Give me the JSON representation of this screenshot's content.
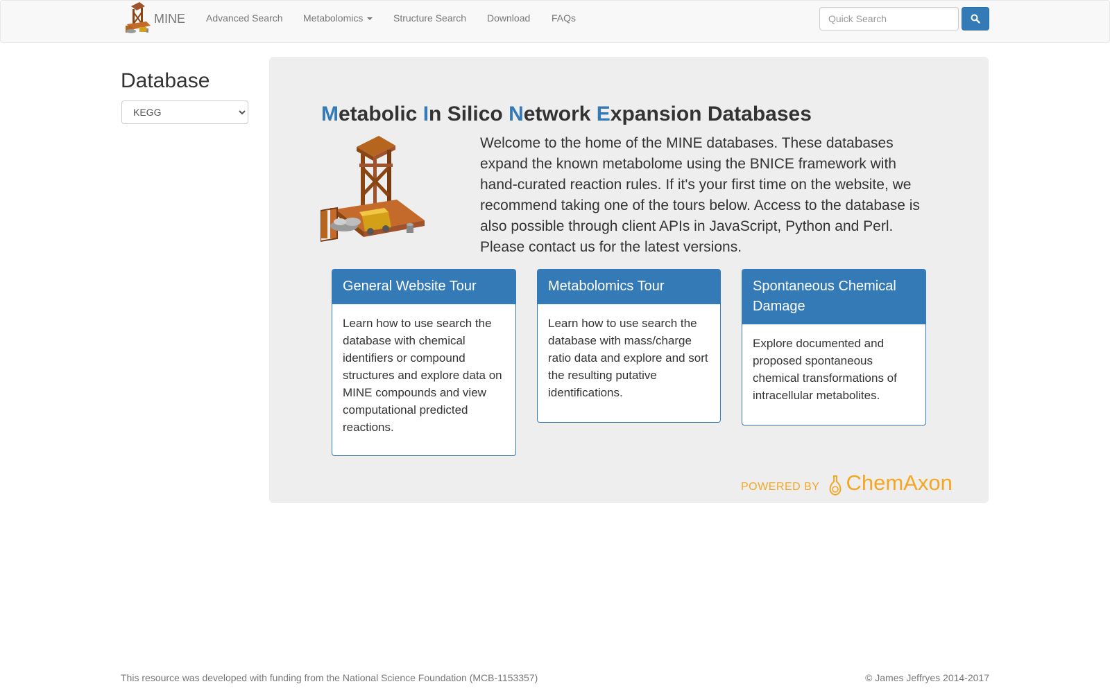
{
  "navbar": {
    "brand": "MINE",
    "links": {
      "advanced_search": "Advanced Search",
      "metabolomics": "Metabolomics",
      "structure_search": "Structure Search",
      "download": "Download",
      "faqs": "FAQs"
    },
    "search_placeholder": "Quick Search",
    "search_icon": "search-icon"
  },
  "sidebar": {
    "heading": "Database",
    "selected_db": "KEGG"
  },
  "jumbotron": {
    "title_parts": {
      "m": "M",
      "etabolic": "etabolic ",
      "i": "I",
      "n_silico": "n Silico ",
      "n": "N",
      "etwork": "etwork ",
      "e": "E",
      "xpansion": "xpansion Databases"
    },
    "intro": "Welcome to the home of the MINE databases. These databases expand the known metabolome using the BNICE framework with hand-curated reaction rules. If it's your first time on the website, we recommend taking one of the tours below. Access to the database is also possible through client APIs in JavaScript, Python and Perl. Please contact us for the latest versions.",
    "tours": [
      {
        "title": "General Website Tour",
        "body": "Learn how to use search the database with chemical identifiers or compound structures and explore data on MINE compounds and view computational predicted reactions."
      },
      {
        "title": "Metabolomics Tour",
        "body": "Learn how to use search the database with mass/charge ratio data and explore and sort the resulting putative identifications."
      },
      {
        "title": "Spontaneous Chemical Damage",
        "body": "Explore documented and proposed spontaneous chemical transformations of intracellular metabolites."
      }
    ],
    "powered_by": "POWERED BY",
    "chemaxon": "ChemAxon"
  },
  "footer": {
    "funding": "This resource was developed with funding from the National Science Foundation (MCB-1153357)",
    "copyright": "© James Jeffryes 2014-2017"
  },
  "colors": {
    "primary": "#337ab7",
    "chemaxon": "#f5a623",
    "jumbotron_bg": "#eeeeee"
  }
}
